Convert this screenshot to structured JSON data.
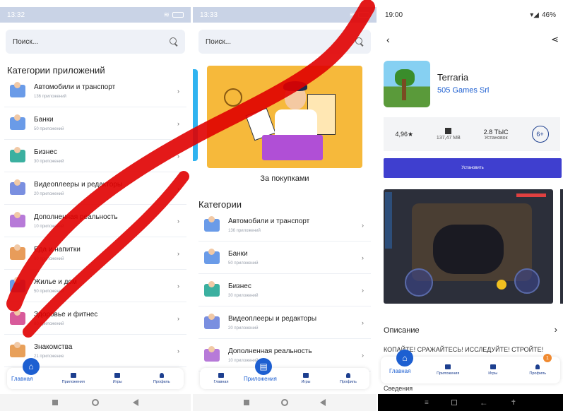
{
  "phone1": {
    "status_time": "13:32",
    "search_placeholder": "Поиск...",
    "section_title": "Категории приложений",
    "categories": [
      {
        "name": "Автомобили и транспорт",
        "count": "136 приложений",
        "color": "#6a9be8"
      },
      {
        "name": "Банки",
        "count": "50 приложений",
        "color": "#6a9be8"
      },
      {
        "name": "Бизнес",
        "count": "30 приложений",
        "color": "#3bb0a0"
      },
      {
        "name": "Видеоплееры и редакторы",
        "count": "20 приложений",
        "color": "#7a8fe0"
      },
      {
        "name": "Дополненная реальность",
        "count": "10 приложений",
        "color": "#b77ad8"
      },
      {
        "name": "Еда и напитки",
        "count": "60 приложений",
        "color": "#e89c5a"
      },
      {
        "name": "Жилье и дом",
        "count": "50 приложений",
        "color": "#6a9be8"
      },
      {
        "name": "Здоровье и фитнес",
        "count": "60 приложений",
        "color": "#d85a9a"
      },
      {
        "name": "Знакомства",
        "count": "21 приложение",
        "color": "#e8a05a"
      }
    ],
    "nav": {
      "home": "Главная",
      "apps": "Приложения",
      "games": "Игры",
      "profile": "Профиль"
    }
  },
  "phone2": {
    "status_time": "13:33",
    "search_placeholder": "Поиск...",
    "promo_caption": "За покупками",
    "section_title": "Категории",
    "categories": [
      {
        "name": "Автомобили и транспорт",
        "count": "136 приложений",
        "color": "#6a9be8"
      },
      {
        "name": "Банки",
        "count": "50 приложений",
        "color": "#6a9be8"
      },
      {
        "name": "Бизнес",
        "count": "30 приложений",
        "color": "#3bb0a0"
      },
      {
        "name": "Видеоплееры и редакторы",
        "count": "20 приложений",
        "color": "#7a8fe0"
      },
      {
        "name": "Дополненная реальность",
        "count": "10 приложений",
        "color": "#b77ad8"
      }
    ],
    "nav": {
      "home": "Главная",
      "apps": "Приложения",
      "games": "Игры",
      "profile": "Профиль"
    }
  },
  "phone3": {
    "status_time": "19:00",
    "battery": "46%",
    "app_name": "Terraria",
    "developer": "505 Games Srl",
    "rating": "4,96★",
    "size": "137,47 MB",
    "installs": "2.8 ТЫС",
    "installs_label": "Установок",
    "age": "6+",
    "install_label": "Установить",
    "description_title": "Описание",
    "description_text": "КОПАЙТЕ! СРАЖАЙТЕСЬ! ИССЛЕДУЙТЕ! СТРОЙТЕ!",
    "more_text": "Сведения",
    "badge": "1",
    "nav": {
      "home": "Главная",
      "apps": "Приложения",
      "games": "Игры",
      "profile": "Профиль"
    }
  },
  "colors": {
    "accent": "#1d5fd1",
    "install": "#3f3fcf",
    "promo": "#f6b93b",
    "watermark": "#e00000"
  }
}
